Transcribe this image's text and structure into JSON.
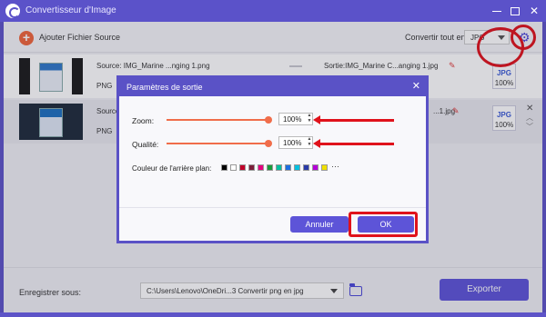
{
  "window": {
    "title": "Convertisseur d'Image",
    "minimize_icon": "minimize-icon",
    "maximize_icon": "maximize-icon",
    "close_icon": "close-icon"
  },
  "toolbar": {
    "add_label": "Ajouter Fichier Source",
    "convert_all_label": "Convertir tout en:",
    "format_value": "JPG",
    "settings_icon": "gear-icon"
  },
  "files": [
    {
      "source": "Source: IMG_Marine ...nging 1.png",
      "format": "PNG",
      "output": "Sortie:IMG_Marine C...anging 1.jpg",
      "out_format": "JPG",
      "quality": "100%"
    },
    {
      "source": "Source",
      "format": "PNG",
      "output": "...1.jpg",
      "out_format": "JPG",
      "quality": "100%"
    }
  ],
  "dialog": {
    "title": "Paramètres de sortie",
    "zoom_label": "Zoom:",
    "zoom_value": "100%",
    "quality_label": "Qualité:",
    "quality_value": "100%",
    "background_label": "Couleur de l'arrière plan:",
    "swatch_colors": [
      "#000000",
      "#ffffff",
      "#c0002a",
      "#7b1f3a",
      "#e5007e",
      "#1a9a3a",
      "#00c0a0",
      "#1e6fe0",
      "#00c0e0",
      "#2a3aa8",
      "#b400d8",
      "#f0e000"
    ],
    "more": "···",
    "cancel_label": "Annuler",
    "ok_label": "OK"
  },
  "footer": {
    "save_label": "Enregistrer sous:",
    "path_value": "C:\\Users\\Lenovo\\OneDri...3 Convertir png en jpg",
    "export_label": "Exporter"
  },
  "colors": {
    "accent": "#5d54d8",
    "highlight": "#e0121b",
    "slider": "#f06d4a"
  }
}
